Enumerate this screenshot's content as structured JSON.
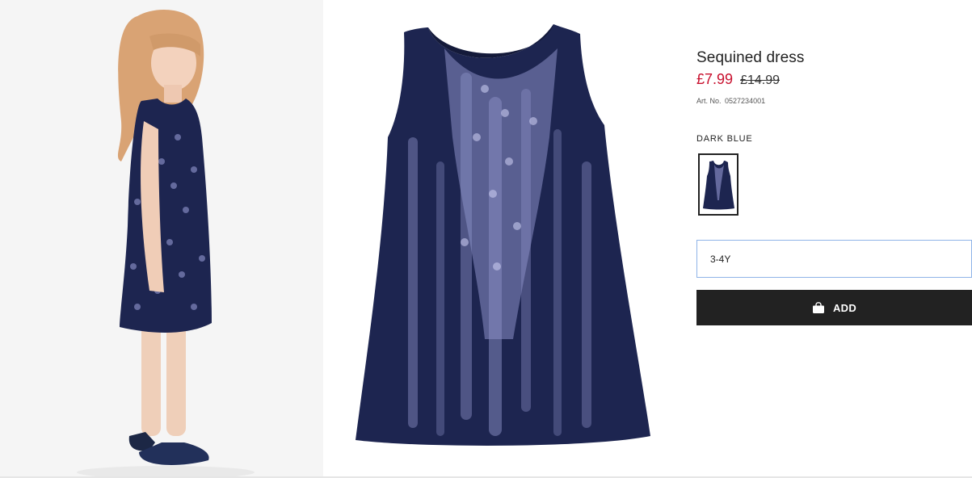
{
  "product": {
    "title": "Sequined dress",
    "price_sale": "£7.99",
    "price_original": "£14.99",
    "article_label": "Art. No.",
    "article_number": "0527234001"
  },
  "color": {
    "selected_label": "DARK BLUE",
    "swatch_color": "#1d2550"
  },
  "size": {
    "selected": "3-4Y"
  },
  "cart": {
    "add_label": "ADD",
    "icon": "shopping-bag-icon"
  },
  "colors": {
    "sale_price": "#c8102e",
    "button_bg": "#222222",
    "select_border": "#8fb4e8",
    "dress_navy": "#1d2550",
    "sequin_highlight": "#9fa3dc"
  }
}
